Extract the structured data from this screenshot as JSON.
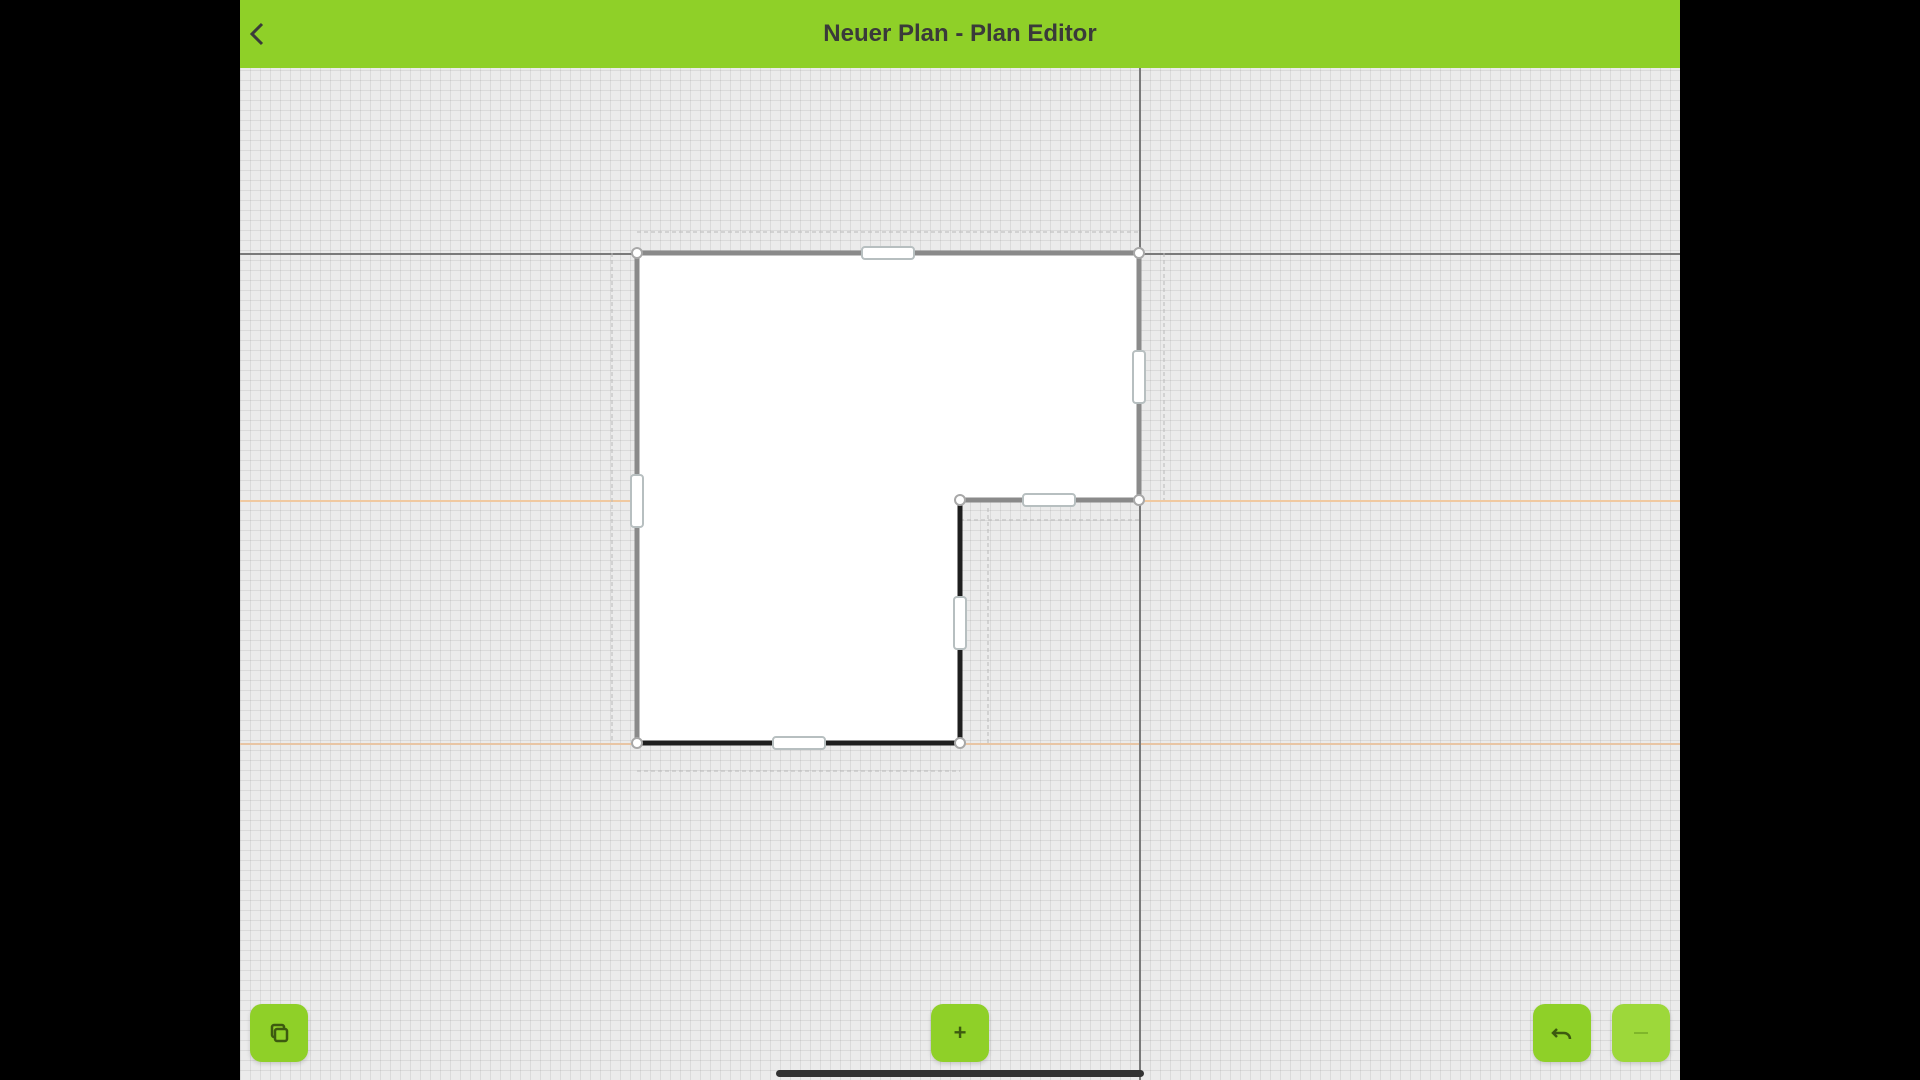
{
  "header": {
    "title": "Neuer Plan - Plan Editor",
    "back_icon": "chevron-left-icon"
  },
  "colors": {
    "header_bg": "#8fd028",
    "canvas_bg": "#ebebeb",
    "wall_active": "#1e1e1e",
    "wall_inactive": "#8a8a8a",
    "guide_orange": "#f0c9a0",
    "guide_dark": "#7a7a7a"
  },
  "plan": {
    "wall_lengths": [],
    "selected_walls": [
      "bottom-wall",
      "inner-vertical-wall"
    ]
  },
  "toolbar": {
    "layers_icon": "layers-icon",
    "add_icon": "plus-icon",
    "add_label": "+",
    "undo_icon": "undo-icon",
    "more_icon": "more-icon"
  }
}
